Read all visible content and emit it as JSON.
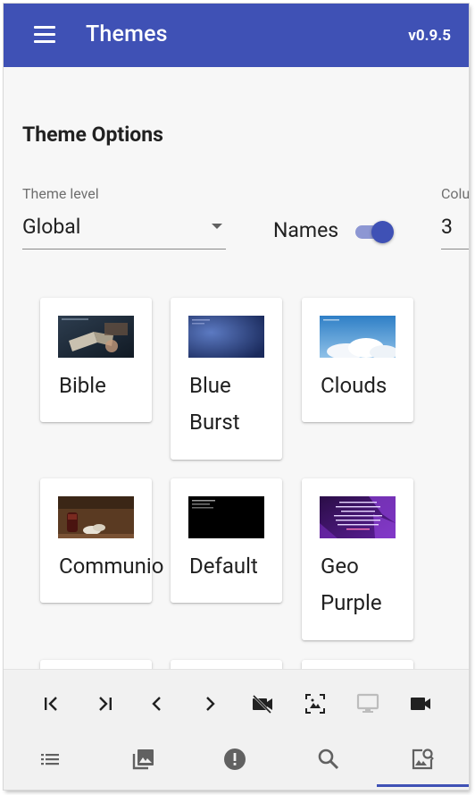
{
  "header": {
    "title": "Themes",
    "version": "v0.9.5",
    "menu_icon": "menu-icon"
  },
  "options": {
    "section_title": "Theme Options",
    "theme_level": {
      "label": "Theme level",
      "value": "Global"
    },
    "names": {
      "label": "Names",
      "enabled": true
    },
    "columns": {
      "label": "Columns",
      "label_visible": "Colu",
      "value": "3"
    }
  },
  "themes": [
    {
      "name": "Bible"
    },
    {
      "name": "Blue Burst"
    },
    {
      "name": "Clouds"
    },
    {
      "name": "Communion",
      "name_visible": "Communio"
    },
    {
      "name": "Default"
    },
    {
      "name": "Geo Purple"
    }
  ],
  "geo_purple_text": "The Lord is good / This is where we be a family / The Lord is good / There is power be a family, family / Get those shadows out in the world, family / Love of the Lord",
  "playback_controls": [
    "first-icon",
    "last-icon",
    "previous-icon",
    "next-icon",
    "video-off-icon",
    "image-fit-icon",
    "monitor-icon",
    "video-camera-icon"
  ],
  "bottom_nav": [
    "playlist-icon",
    "images-icon",
    "alert-icon",
    "search-icon",
    "theme-search-icon"
  ],
  "colors": {
    "primary": "#3f51b5",
    "toggle_track": "#8d97d3"
  }
}
